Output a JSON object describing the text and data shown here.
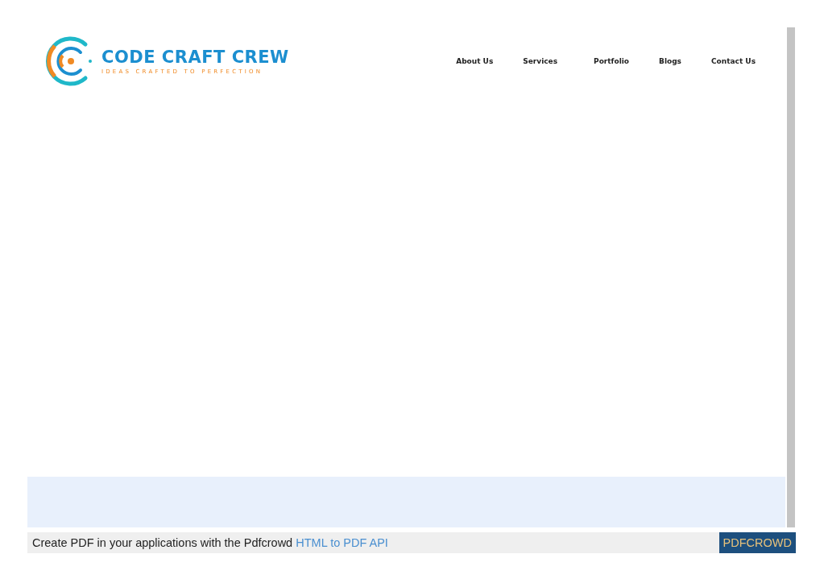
{
  "header": {
    "logo": {
      "title": "CODE CRAFT CREW",
      "tagline": "IDEAS CRAFTED TO PERFECTION"
    },
    "nav": [
      {
        "label": "About Us"
      },
      {
        "label": "Services"
      },
      {
        "label": "Portfolio"
      },
      {
        "label": "Blogs"
      },
      {
        "label": "Contact Us"
      }
    ]
  },
  "footer_bar": {
    "text": "Create PDF in your applications with the Pdfcrowd ",
    "link": "HTML to PDF API",
    "button": "PDFCROWD"
  }
}
